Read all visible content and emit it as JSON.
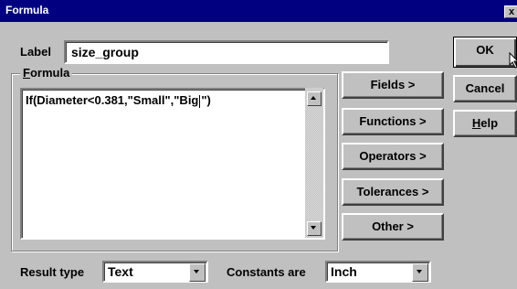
{
  "window": {
    "title": "Formula",
    "close_glyph": "x"
  },
  "label": {
    "caption": "Label",
    "value": "size_group"
  },
  "formula": {
    "legend_underlined": "F",
    "legend_rest": "ormula",
    "text_before_caret": "If(Diameter<0.381,\"Small\",\"Big",
    "text_after_caret": "\")"
  },
  "buttons": {
    "ok": "OK",
    "cancel": "Cancel",
    "help_underlined": "H",
    "help_rest": "elp",
    "fields": "Fields >",
    "functions": "Functions >",
    "operators": "Operators >",
    "tolerances": "Tolerances >",
    "other": "Other >"
  },
  "result_type": {
    "caption": "Result type",
    "value": "Text"
  },
  "constants": {
    "caption": "Constants are",
    "value": "Inch"
  },
  "icons": [
    "close-icon",
    "scroll-up-icon",
    "scroll-down-icon",
    "dropdown-arrow-icon",
    "mouse-pointer-icon"
  ]
}
